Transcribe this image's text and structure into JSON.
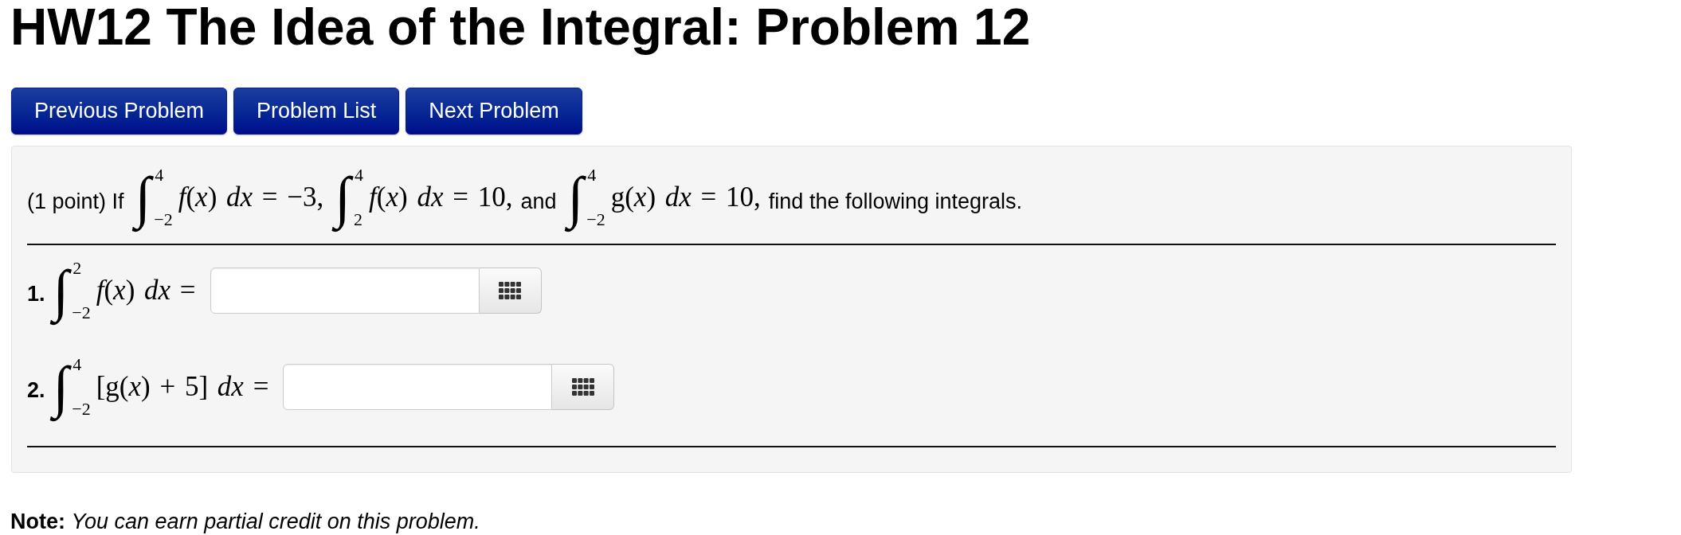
{
  "title": "HW12 The Idea of the Integral: Problem 12",
  "nav_buttons": [
    {
      "label": "Previous Problem"
    },
    {
      "label": "Problem List"
    },
    {
      "label": "Next Problem"
    }
  ],
  "problem": {
    "statement": [
      {
        "kind": "text",
        "text": "(1 point) If"
      },
      {
        "kind": "integral",
        "sign": "∫",
        "upper": "4",
        "lower": "−2",
        "integrand": "*f*(*x*) *dx* = −3,"
      },
      {
        "kind": "integral",
        "sign": "∫",
        "upper": "4",
        "lower": "2",
        "integrand": "*f*(*x*) *dx* = 10,"
      },
      {
        "kind": "text",
        "text": "and"
      },
      {
        "kind": "integral",
        "sign": "∫",
        "upper": "4",
        "lower": "−2",
        "integrand": "g(*x*) *dx* = 10,"
      },
      {
        "kind": "text",
        "text": "find the following integrals."
      }
    ],
    "items": [
      {
        "number": "1.",
        "integral": {
          "sign": "∫",
          "upper": "2",
          "lower": "−2",
          "integrand": "*f*(*x*) *dx* ="
        }
      },
      {
        "number": "2.",
        "integral": {
          "sign": "∫",
          "upper": "4",
          "lower": "−2",
          "integrand": "[g(*x*) + 5] *dx* ="
        }
      }
    ]
  },
  "note": "**Note:** *You can earn partial credit on this problem.*"
}
